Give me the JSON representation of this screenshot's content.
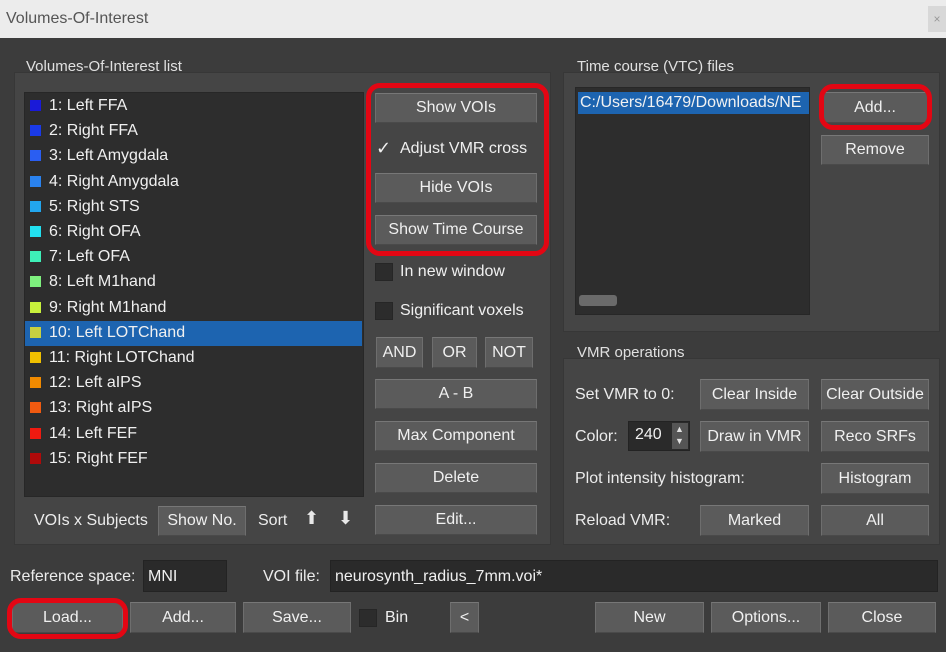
{
  "window": {
    "title": "Volumes-Of-Interest",
    "close": "×"
  },
  "voi_panel": {
    "label": "Volumes-Of-Interest list",
    "items": [
      {
        "label": "1: Left FFA",
        "color": "#1a1ad8"
      },
      {
        "label": "2: Right FFA",
        "color": "#1a3ae8"
      },
      {
        "label": "3: Left Amygdala",
        "color": "#2a5ef2"
      },
      {
        "label": "4: Right Amygdala",
        "color": "#2a82ee"
      },
      {
        "label": "5: Right STS",
        "color": "#22a6ee"
      },
      {
        "label": "6: Right OFA",
        "color": "#22e0f0"
      },
      {
        "label": "7: Left OFA",
        "color": "#3ef0b8"
      },
      {
        "label": "8: Left M1hand",
        "color": "#7ef07e"
      },
      {
        "label": "9: Right M1hand",
        "color": "#c8f03c"
      },
      {
        "label": "10: Left LOTChand",
        "color": "#c8d040"
      },
      {
        "label": "11: Right LOTChand",
        "color": "#f0c000"
      },
      {
        "label": "12: Left aIPS",
        "color": "#f08a00"
      },
      {
        "label": "13: Right aIPS",
        "color": "#f05a10"
      },
      {
        "label": "14: Left FEF",
        "color": "#f01a10"
      },
      {
        "label": "15: Right FEF",
        "color": "#b00a0a"
      }
    ],
    "selected_index": 9,
    "vois_x_subjects": "VOIs x Subjects",
    "show_no": "Show No.",
    "sort": "Sort",
    "sort_up": "⬆",
    "sort_down": "⬇"
  },
  "buttons": {
    "show_vois": "Show VOIs",
    "adjust_vmr": "Adjust VMR cross",
    "check": "✓",
    "hide_vois": "Hide VOIs",
    "show_time_course": "Show Time Course",
    "in_new_window": "In new window",
    "significant_voxels": "Significant voxels",
    "and": "AND",
    "or": "OR",
    "not": "NOT",
    "a_minus_b": "A - B",
    "max_component": "Max Component",
    "delete": "Delete",
    "edit": "Edit..."
  },
  "vtc_panel": {
    "label": "Time course (VTC) files",
    "file": "C:/Users/16479/Downloads/NE",
    "add": "Add...",
    "remove": "Remove"
  },
  "vmr_panel": {
    "label": "VMR operations",
    "set_vmr": "Set VMR to 0:",
    "clear_inside": "Clear Inside",
    "clear_outside": "Clear Outside",
    "color_label": "Color:",
    "color_value": "240",
    "spin_up": "▲",
    "spin_down": "▼",
    "draw_in_vmr": "Draw in VMR",
    "reco_srfs": "Reco SRFs",
    "plot_hist": "Plot intensity histogram:",
    "histogram": "Histogram",
    "reload_vmr": "Reload VMR:",
    "marked": "Marked",
    "all": "All"
  },
  "bottom": {
    "reference_space_label": "Reference space:",
    "reference_space_value": "MNI",
    "voi_file_label": "VOI file:",
    "voi_file_value": "neurosynth_radius_7mm.voi*",
    "load": "Load...",
    "add": "Add...",
    "save": "Save...",
    "bin": "Bin",
    "prev": "<",
    "new": "New",
    "options": "Options...",
    "close": "Close"
  }
}
